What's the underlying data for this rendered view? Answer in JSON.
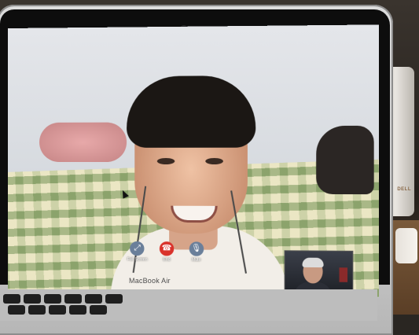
{
  "call": {
    "controls": [
      {
        "icon": "expand-icon",
        "label": "Full Screen",
        "color": "#6a7f9a"
      },
      {
        "icon": "end-call-icon",
        "label": "End",
        "color": "#d9322b"
      },
      {
        "icon": "microphone-icon",
        "label": "Mute",
        "color": "#6a7f9a"
      }
    ]
  },
  "device": {
    "brand": "MacBook Air",
    "speaker_brand": "DELL"
  }
}
